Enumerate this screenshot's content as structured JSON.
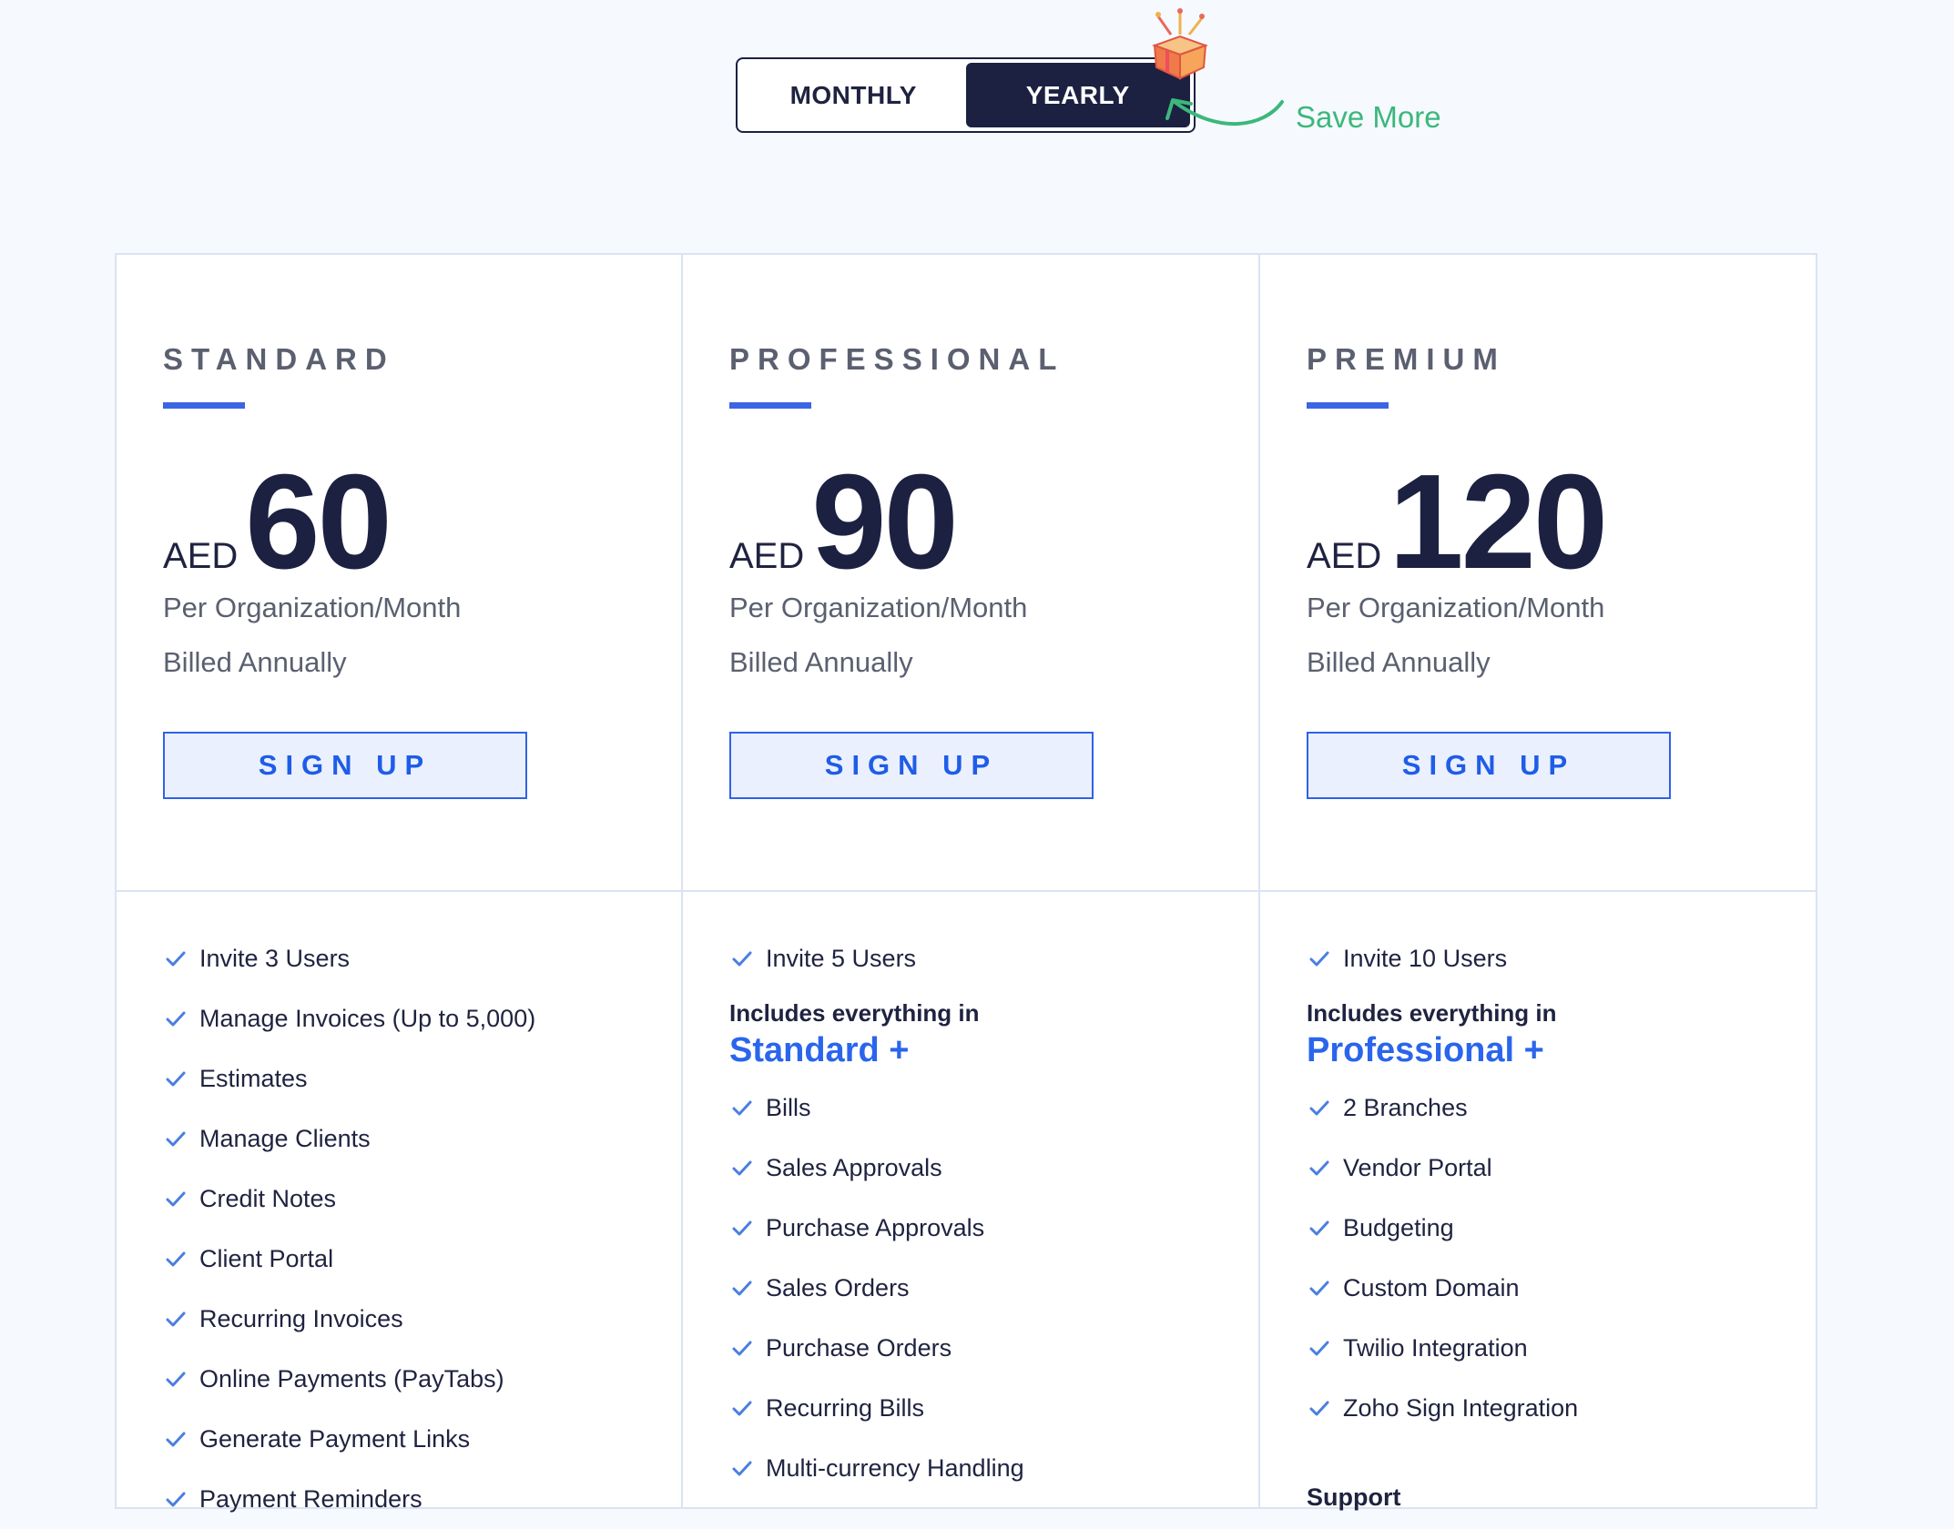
{
  "toggle": {
    "monthly": "MONTHLY",
    "yearly": "YEARLY"
  },
  "save_more": "Save More",
  "colors": {
    "dark": "#1c2142",
    "accent": "#2f62e6",
    "save_green": "#3bb87a"
  },
  "plans": [
    {
      "name": "STANDARD",
      "currency": "AED",
      "price": "60",
      "period": "Per Organization/Month",
      "billing": "Billed Annually",
      "cta": "SIGN UP",
      "first_feature": "Invite 3 Users",
      "features": [
        "Manage Invoices (Up to 5,000)",
        "Estimates",
        "Manage Clients",
        "Credit Notes",
        "Client Portal",
        "Recurring Invoices",
        "Online Payments (PayTabs)",
        "Generate Payment Links",
        "Payment Reminders"
      ]
    },
    {
      "name": "PROFESSIONAL",
      "currency": "AED",
      "price": "90",
      "period": "Per Organization/Month",
      "billing": "Billed Annually",
      "cta": "SIGN UP",
      "first_feature": "Invite 5 Users",
      "includes_text": "Includes everything in",
      "includes_plan": "Standard +",
      "features": [
        "Bills",
        "Sales Approvals",
        "Purchase Approvals",
        "Sales Orders",
        "Purchase Orders",
        "Recurring Bills",
        "Multi-currency Handling"
      ]
    },
    {
      "name": "PREMIUM",
      "currency": "AED",
      "price": "120",
      "period": "Per Organization/Month",
      "billing": "Billed Annually",
      "cta": "SIGN UP",
      "first_feature": "Invite 10 Users",
      "includes_text": "Includes everything in",
      "includes_plan": "Professional +",
      "features": [
        "2 Branches",
        "Vendor Portal",
        "Budgeting",
        "Custom Domain",
        "Twilio Integration",
        "Zoho Sign Integration"
      ],
      "support_heading": "Support"
    }
  ]
}
